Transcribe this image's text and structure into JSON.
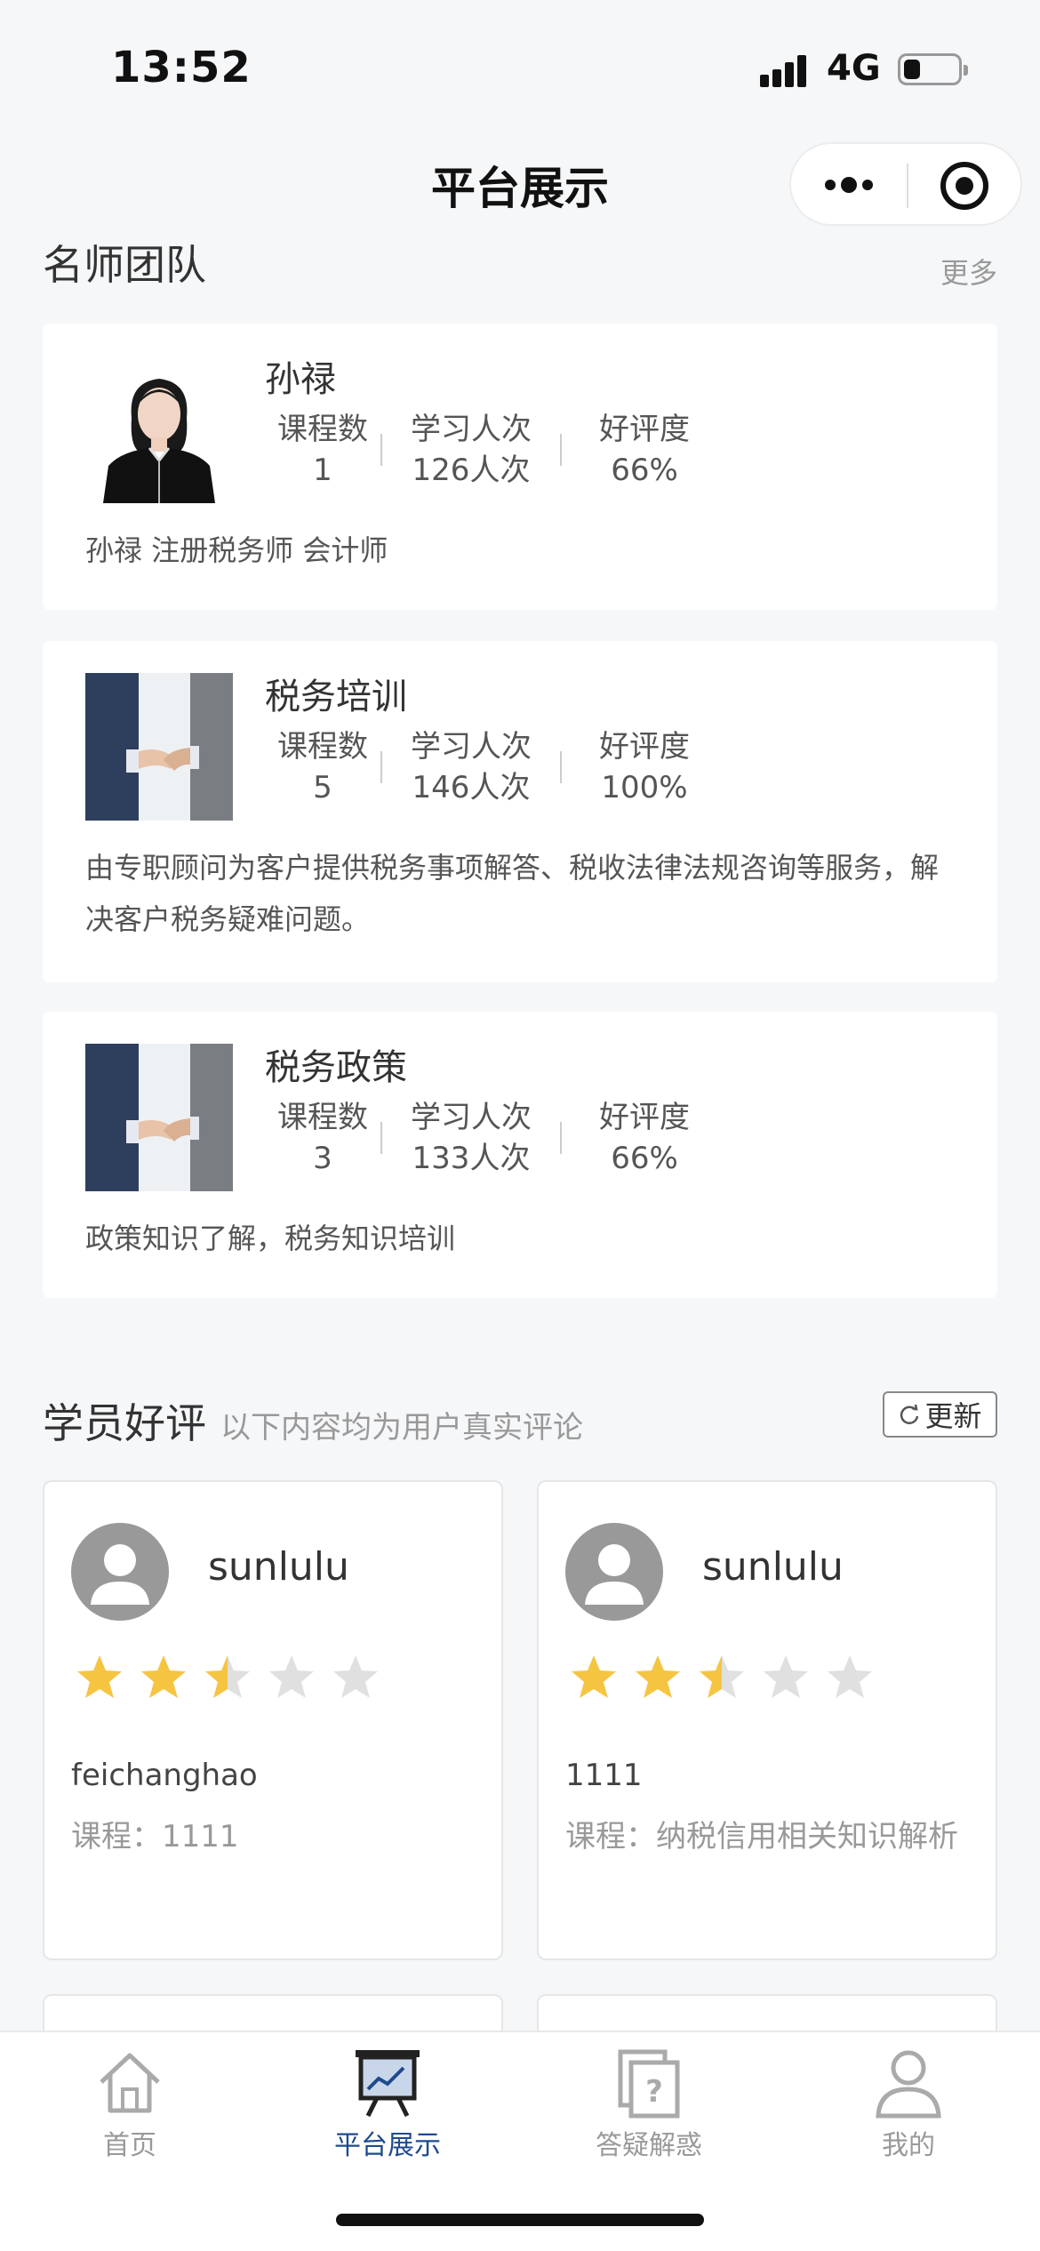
{
  "status_bar": {
    "time": "13:52",
    "network": "4G",
    "battery_level": 0.2
  },
  "nav": {
    "title": "平台展示"
  },
  "teachers_section": {
    "title": "名师团队",
    "more": "更多",
    "stat_labels": {
      "courses": "课程数",
      "learners": "学习人次",
      "rating": "好评度"
    },
    "cards": [
      {
        "name": "孙禄",
        "courses": "1",
        "learners": "126人次",
        "rating": "66%",
        "desc": "孙禄 注册税务师 会计师",
        "thumb": "teacher-portrait"
      },
      {
        "name": "税务培训",
        "courses": "5",
        "learners": "146人次",
        "rating": "100%",
        "desc": "由专职顾问为客户提供税务事项解答、税收法律法规咨询等服务，解决客户税务疑难问题。",
        "thumb": "handshake-image"
      },
      {
        "name": "税务政策",
        "courses": "3",
        "learners": "133人次",
        "rating": "66%",
        "desc": "政策知识了解，税务知识培训",
        "thumb": "handshake-image"
      }
    ]
  },
  "reviews_section": {
    "title": "学员好评",
    "subtitle": "以下内容均为用户真实评论",
    "refresh_label": "更新",
    "reviews": [
      {
        "user": "sunlulu",
        "rating": 2.5,
        "content": "feichanghao",
        "course": "课程：1111"
      },
      {
        "user": "sunlulu",
        "rating": 2.5,
        "content": "1111",
        "course": "课程：纳税信用相关知识解析"
      }
    ]
  },
  "tabbar": {
    "items": [
      {
        "label": "首页",
        "icon": "home-icon",
        "active": false
      },
      {
        "label": "平台展示",
        "icon": "presentation-icon",
        "active": true
      },
      {
        "label": "答疑解惑",
        "icon": "question-icon",
        "active": false
      },
      {
        "label": "我的",
        "icon": "user-icon",
        "active": false
      }
    ]
  },
  "colors": {
    "accent": "#1e4a8c",
    "star": "#f5c542",
    "star_empty": "#e0e0e0"
  }
}
